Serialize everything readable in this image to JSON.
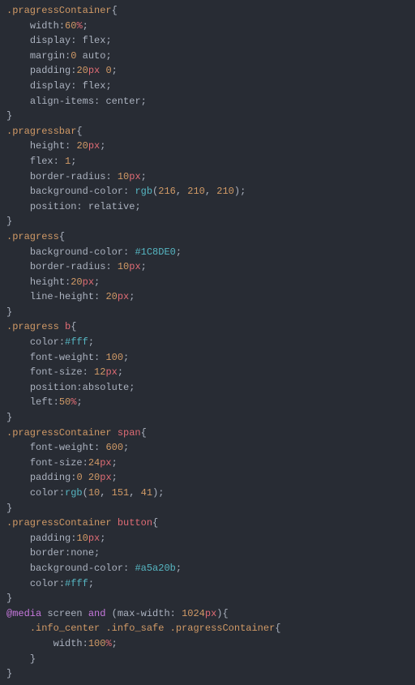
{
  "lines": [
    {
      "indent": 0,
      "tokens": [
        {
          "c": "sel",
          "t": ".pragressContainer"
        },
        {
          "c": "punc",
          "t": "{"
        }
      ]
    },
    {
      "indent": 1,
      "tokens": [
        {
          "c": "prop",
          "t": "width"
        },
        {
          "c": "punc",
          "t": ":"
        },
        {
          "c": "num",
          "t": "60"
        },
        {
          "c": "unit",
          "t": "%"
        },
        {
          "c": "punc",
          "t": ";"
        }
      ]
    },
    {
      "indent": 1,
      "tokens": [
        {
          "c": "prop",
          "t": "display"
        },
        {
          "c": "punc",
          "t": ": "
        },
        {
          "c": "val",
          "t": "flex"
        },
        {
          "c": "punc",
          "t": ";"
        }
      ]
    },
    {
      "indent": 1,
      "tokens": [
        {
          "c": "prop",
          "t": "margin"
        },
        {
          "c": "punc",
          "t": ":"
        },
        {
          "c": "num",
          "t": "0"
        },
        {
          "c": "val",
          "t": " auto"
        },
        {
          "c": "punc",
          "t": ";"
        }
      ]
    },
    {
      "indent": 1,
      "tokens": [
        {
          "c": "prop",
          "t": "padding"
        },
        {
          "c": "punc",
          "t": ":"
        },
        {
          "c": "num",
          "t": "20"
        },
        {
          "c": "unit",
          "t": "px"
        },
        {
          "c": "val",
          "t": " "
        },
        {
          "c": "num",
          "t": "0"
        },
        {
          "c": "punc",
          "t": ";"
        }
      ]
    },
    {
      "indent": 1,
      "tokens": [
        {
          "c": "prop",
          "t": "display"
        },
        {
          "c": "punc",
          "t": ": "
        },
        {
          "c": "val",
          "t": "flex"
        },
        {
          "c": "punc",
          "t": ";"
        }
      ]
    },
    {
      "indent": 1,
      "tokens": [
        {
          "c": "prop",
          "t": "align-items"
        },
        {
          "c": "punc",
          "t": ": "
        },
        {
          "c": "val",
          "t": "center"
        },
        {
          "c": "punc",
          "t": ";"
        }
      ]
    },
    {
      "indent": 0,
      "tokens": [
        {
          "c": "punc",
          "t": "}"
        }
      ]
    },
    {
      "indent": 0,
      "tokens": [
        {
          "c": "sel",
          "t": ".pragressbar"
        },
        {
          "c": "punc",
          "t": "{"
        }
      ]
    },
    {
      "indent": 1,
      "tokens": [
        {
          "c": "prop",
          "t": "height"
        },
        {
          "c": "punc",
          "t": ": "
        },
        {
          "c": "num",
          "t": "20"
        },
        {
          "c": "unit",
          "t": "px"
        },
        {
          "c": "punc",
          "t": ";"
        }
      ]
    },
    {
      "indent": 1,
      "tokens": [
        {
          "c": "prop",
          "t": "flex"
        },
        {
          "c": "punc",
          "t": ": "
        },
        {
          "c": "num",
          "t": "1"
        },
        {
          "c": "punc",
          "t": ";"
        }
      ]
    },
    {
      "indent": 1,
      "tokens": [
        {
          "c": "prop",
          "t": "border-radius"
        },
        {
          "c": "punc",
          "t": ": "
        },
        {
          "c": "num",
          "t": "10"
        },
        {
          "c": "unit",
          "t": "px"
        },
        {
          "c": "punc",
          "t": ";"
        }
      ]
    },
    {
      "indent": 1,
      "tokens": [
        {
          "c": "prop",
          "t": "background-color"
        },
        {
          "c": "punc",
          "t": ": "
        },
        {
          "c": "func",
          "t": "rgb"
        },
        {
          "c": "paren",
          "t": "("
        },
        {
          "c": "num",
          "t": "216"
        },
        {
          "c": "comma",
          "t": ", "
        },
        {
          "c": "num",
          "t": "210"
        },
        {
          "c": "comma",
          "t": ", "
        },
        {
          "c": "num",
          "t": "210"
        },
        {
          "c": "paren",
          "t": ")"
        },
        {
          "c": "punc",
          "t": ";"
        }
      ]
    },
    {
      "indent": 1,
      "tokens": [
        {
          "c": "prop",
          "t": "position"
        },
        {
          "c": "punc",
          "t": ": "
        },
        {
          "c": "val",
          "t": "relative"
        },
        {
          "c": "punc",
          "t": ";"
        }
      ]
    },
    {
      "indent": 0,
      "tokens": [
        {
          "c": "punc",
          "t": "}"
        }
      ]
    },
    {
      "indent": 0,
      "tokens": [
        {
          "c": "sel",
          "t": ".pragress"
        },
        {
          "c": "punc",
          "t": "{"
        }
      ]
    },
    {
      "indent": 1,
      "tokens": [
        {
          "c": "prop",
          "t": "background-color"
        },
        {
          "c": "punc",
          "t": ": "
        },
        {
          "c": "hex",
          "t": "#1C8DE0"
        },
        {
          "c": "punc",
          "t": ";"
        }
      ]
    },
    {
      "indent": 1,
      "tokens": [
        {
          "c": "prop",
          "t": "border-radius"
        },
        {
          "c": "punc",
          "t": ": "
        },
        {
          "c": "num",
          "t": "10"
        },
        {
          "c": "unit",
          "t": "px"
        },
        {
          "c": "punc",
          "t": ";"
        }
      ]
    },
    {
      "indent": 1,
      "tokens": [
        {
          "c": "prop",
          "t": "height"
        },
        {
          "c": "punc",
          "t": ":"
        },
        {
          "c": "num",
          "t": "20"
        },
        {
          "c": "unit",
          "t": "px"
        },
        {
          "c": "punc",
          "t": ";"
        }
      ]
    },
    {
      "indent": 1,
      "tokens": [
        {
          "c": "prop",
          "t": "line-height"
        },
        {
          "c": "punc",
          "t": ": "
        },
        {
          "c": "num",
          "t": "20"
        },
        {
          "c": "unit",
          "t": "px"
        },
        {
          "c": "punc",
          "t": ";"
        }
      ]
    },
    {
      "indent": 0,
      "tokens": [
        {
          "c": "punc",
          "t": "}"
        }
      ]
    },
    {
      "indent": 0,
      "tokens": [
        {
          "c": "sel",
          "t": ".pragress"
        },
        {
          "c": "sel",
          "t": " "
        },
        {
          "c": "tag",
          "t": "b"
        },
        {
          "c": "punc",
          "t": "{"
        }
      ]
    },
    {
      "indent": 1,
      "tokens": [
        {
          "c": "prop",
          "t": "color"
        },
        {
          "c": "punc",
          "t": ":"
        },
        {
          "c": "hex",
          "t": "#fff"
        },
        {
          "c": "punc",
          "t": ";"
        }
      ]
    },
    {
      "indent": 1,
      "tokens": [
        {
          "c": "prop",
          "t": "font-weight"
        },
        {
          "c": "punc",
          "t": ": "
        },
        {
          "c": "num",
          "t": "100"
        },
        {
          "c": "punc",
          "t": ";"
        }
      ]
    },
    {
      "indent": 1,
      "tokens": [
        {
          "c": "prop",
          "t": "font-size"
        },
        {
          "c": "punc",
          "t": ": "
        },
        {
          "c": "num",
          "t": "12"
        },
        {
          "c": "unit",
          "t": "px"
        },
        {
          "c": "punc",
          "t": ";"
        }
      ]
    },
    {
      "indent": 1,
      "tokens": [
        {
          "c": "prop",
          "t": "position"
        },
        {
          "c": "punc",
          "t": ":"
        },
        {
          "c": "val",
          "t": "absolute"
        },
        {
          "c": "punc",
          "t": ";"
        }
      ]
    },
    {
      "indent": 1,
      "tokens": [
        {
          "c": "prop",
          "t": "left"
        },
        {
          "c": "punc",
          "t": ":"
        },
        {
          "c": "num",
          "t": "50"
        },
        {
          "c": "unit",
          "t": "%"
        },
        {
          "c": "punc",
          "t": ";"
        }
      ]
    },
    {
      "indent": 0,
      "tokens": [
        {
          "c": "punc",
          "t": "}"
        }
      ]
    },
    {
      "indent": 0,
      "tokens": [
        {
          "c": "sel",
          "t": ".pragressContainer"
        },
        {
          "c": "sel",
          "t": " "
        },
        {
          "c": "tag",
          "t": "span"
        },
        {
          "c": "punc",
          "t": "{"
        }
      ]
    },
    {
      "indent": 1,
      "tokens": [
        {
          "c": "prop",
          "t": "font-weight"
        },
        {
          "c": "punc",
          "t": ": "
        },
        {
          "c": "num",
          "t": "600"
        },
        {
          "c": "punc",
          "t": ";"
        }
      ]
    },
    {
      "indent": 1,
      "tokens": [
        {
          "c": "prop",
          "t": "font-size"
        },
        {
          "c": "punc",
          "t": ":"
        },
        {
          "c": "num",
          "t": "24"
        },
        {
          "c": "unit",
          "t": "px"
        },
        {
          "c": "punc",
          "t": ";"
        }
      ]
    },
    {
      "indent": 1,
      "tokens": [
        {
          "c": "prop",
          "t": "padding"
        },
        {
          "c": "punc",
          "t": ":"
        },
        {
          "c": "num",
          "t": "0"
        },
        {
          "c": "val",
          "t": " "
        },
        {
          "c": "num",
          "t": "20"
        },
        {
          "c": "unit",
          "t": "px"
        },
        {
          "c": "punc",
          "t": ";"
        }
      ]
    },
    {
      "indent": 1,
      "tokens": [
        {
          "c": "prop",
          "t": "color"
        },
        {
          "c": "punc",
          "t": ":"
        },
        {
          "c": "func",
          "t": "rgb"
        },
        {
          "c": "paren",
          "t": "("
        },
        {
          "c": "num",
          "t": "10"
        },
        {
          "c": "comma",
          "t": ", "
        },
        {
          "c": "num",
          "t": "151"
        },
        {
          "c": "comma",
          "t": ", "
        },
        {
          "c": "num",
          "t": "41"
        },
        {
          "c": "paren",
          "t": ")"
        },
        {
          "c": "punc",
          "t": ";"
        }
      ]
    },
    {
      "indent": 0,
      "tokens": [
        {
          "c": "punc",
          "t": "}"
        }
      ]
    },
    {
      "indent": 0,
      "tokens": [
        {
          "c": "sel",
          "t": ".pragressContainer"
        },
        {
          "c": "sel",
          "t": " "
        },
        {
          "c": "tag",
          "t": "button"
        },
        {
          "c": "punc",
          "t": "{"
        }
      ]
    },
    {
      "indent": 1,
      "tokens": [
        {
          "c": "prop",
          "t": "padding"
        },
        {
          "c": "punc",
          "t": ":"
        },
        {
          "c": "num",
          "t": "10"
        },
        {
          "c": "unit",
          "t": "px"
        },
        {
          "c": "punc",
          "t": ";"
        }
      ]
    },
    {
      "indent": 1,
      "tokens": [
        {
          "c": "prop",
          "t": "border"
        },
        {
          "c": "punc",
          "t": ":"
        },
        {
          "c": "val",
          "t": "none"
        },
        {
          "c": "punc",
          "t": ";"
        }
      ]
    },
    {
      "indent": 1,
      "tokens": [
        {
          "c": "prop",
          "t": "background-color"
        },
        {
          "c": "punc",
          "t": ": "
        },
        {
          "c": "hex",
          "t": "#a5a20b"
        },
        {
          "c": "punc",
          "t": ";"
        }
      ]
    },
    {
      "indent": 1,
      "tokens": [
        {
          "c": "prop",
          "t": "color"
        },
        {
          "c": "punc",
          "t": ":"
        },
        {
          "c": "hex",
          "t": "#fff"
        },
        {
          "c": "punc",
          "t": ";"
        }
      ]
    },
    {
      "indent": 0,
      "tokens": [
        {
          "c": "punc",
          "t": "}"
        }
      ]
    },
    {
      "indent": 0,
      "tokens": [
        {
          "c": "kw",
          "t": "@media"
        },
        {
          "c": "val",
          "t": " screen "
        },
        {
          "c": "kw",
          "t": "and"
        },
        {
          "c": "val",
          "t": " "
        },
        {
          "c": "paren",
          "t": "("
        },
        {
          "c": "prop",
          "t": "max-width"
        },
        {
          "c": "punc",
          "t": ": "
        },
        {
          "c": "num",
          "t": "1024"
        },
        {
          "c": "unit",
          "t": "px"
        },
        {
          "c": "paren",
          "t": ")"
        },
        {
          "c": "punc",
          "t": "{"
        }
      ]
    },
    {
      "indent": 1,
      "tokens": [
        {
          "c": "sel",
          "t": ".info_center"
        },
        {
          "c": "sel",
          "t": " "
        },
        {
          "c": "sel",
          "t": ".info_safe"
        },
        {
          "c": "sel",
          "t": " "
        },
        {
          "c": "sel",
          "t": ".pragressContainer"
        },
        {
          "c": "punc",
          "t": "{"
        }
      ]
    },
    {
      "indent": 2,
      "tokens": [
        {
          "c": "prop",
          "t": "width"
        },
        {
          "c": "punc",
          "t": ":"
        },
        {
          "c": "num",
          "t": "100"
        },
        {
          "c": "unit",
          "t": "%"
        },
        {
          "c": "punc",
          "t": ";"
        }
      ]
    },
    {
      "indent": 1,
      "tokens": [
        {
          "c": "punc",
          "t": "}"
        }
      ]
    },
    {
      "indent": 0,
      "tokens": [
        {
          "c": "punc",
          "t": "}"
        }
      ]
    }
  ]
}
